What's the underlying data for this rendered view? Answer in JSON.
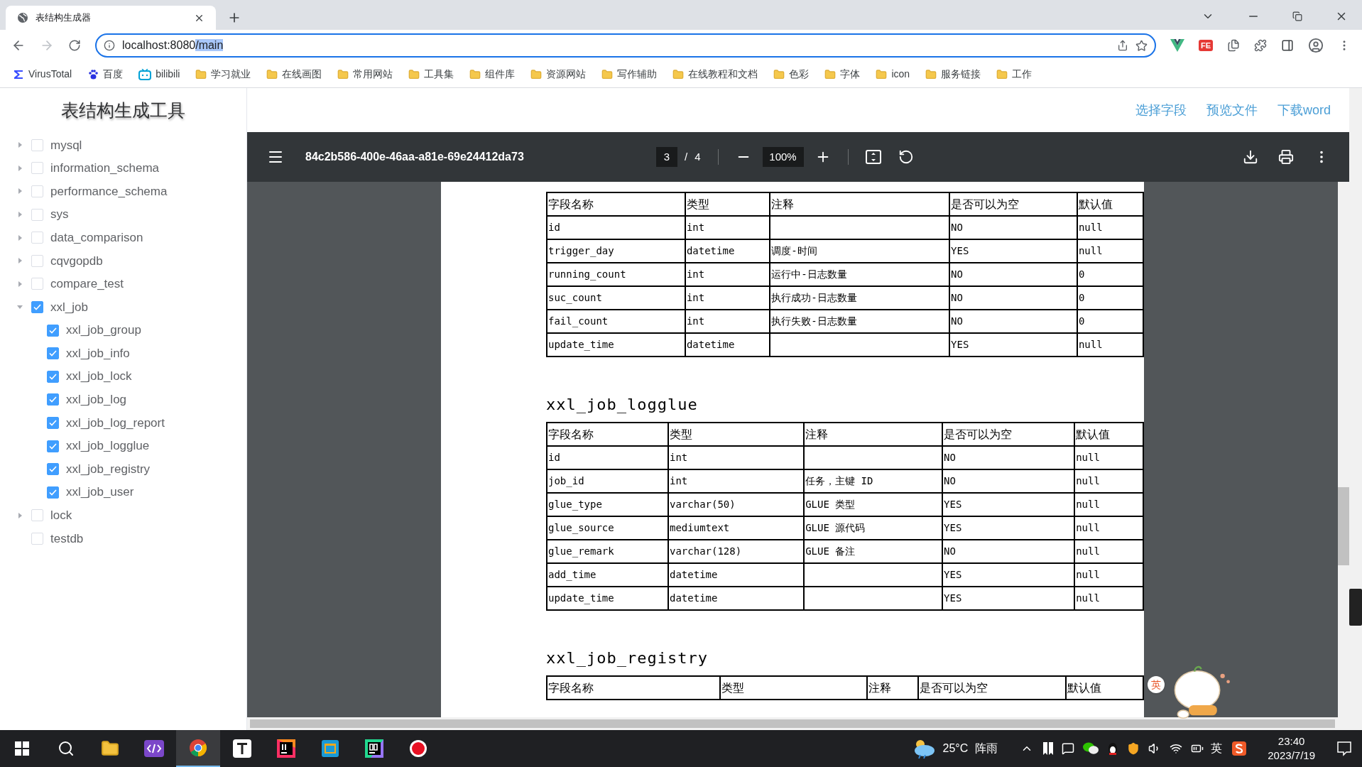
{
  "browser": {
    "tab_title": "表结构生成器",
    "address": {
      "host": "localhost:8080",
      "path": "/main",
      "path_selected": true
    },
    "bookmarks": [
      {
        "kind": "virustotal",
        "label": "VirusTotal"
      },
      {
        "kind": "baidu",
        "label": "百度"
      },
      {
        "kind": "bilibili",
        "label": "bilibili"
      },
      {
        "kind": "folder",
        "label": "学习就业"
      },
      {
        "kind": "folder",
        "label": "在线画图"
      },
      {
        "kind": "folder",
        "label": "常用网站"
      },
      {
        "kind": "folder",
        "label": "工具集"
      },
      {
        "kind": "folder",
        "label": "组件库"
      },
      {
        "kind": "folder",
        "label": "资源网站"
      },
      {
        "kind": "folder",
        "label": "写作辅助"
      },
      {
        "kind": "folder",
        "label": "在线教程和文档"
      },
      {
        "kind": "folder",
        "label": "色彩"
      },
      {
        "kind": "folder",
        "label": "字体"
      },
      {
        "kind": "folder",
        "label": "icon"
      },
      {
        "kind": "folder",
        "label": "服务链接"
      },
      {
        "kind": "folder",
        "label": "工作"
      }
    ]
  },
  "sidebar": {
    "title": "表结构生成工具",
    "tree": [
      {
        "label": "mysql",
        "expandable": true,
        "expanded": false,
        "checked": false
      },
      {
        "label": "information_schema",
        "expandable": true,
        "expanded": false,
        "checked": false
      },
      {
        "label": "performance_schema",
        "expandable": true,
        "expanded": false,
        "checked": false
      },
      {
        "label": "sys",
        "expandable": true,
        "expanded": false,
        "checked": false
      },
      {
        "label": "data_comparison",
        "expandable": true,
        "expanded": false,
        "checked": false
      },
      {
        "label": "cqvgopdb",
        "expandable": true,
        "expanded": false,
        "checked": false
      },
      {
        "label": "compare_test",
        "expandable": true,
        "expanded": false,
        "checked": false
      },
      {
        "label": "xxl_job",
        "expandable": true,
        "expanded": true,
        "checked": true,
        "children": [
          {
            "label": "xxl_job_group",
            "checked": true
          },
          {
            "label": "xxl_job_info",
            "checked": true
          },
          {
            "label": "xxl_job_lock",
            "checked": true
          },
          {
            "label": "xxl_job_log",
            "checked": true
          },
          {
            "label": "xxl_job_log_report",
            "checked": true
          },
          {
            "label": "xxl_job_logglue",
            "checked": true
          },
          {
            "label": "xxl_job_registry",
            "checked": true
          },
          {
            "label": "xxl_job_user",
            "checked": true
          }
        ]
      },
      {
        "label": "lock",
        "expandable": true,
        "expanded": false,
        "checked": false
      },
      {
        "label": "testdb",
        "expandable": false,
        "checked": false
      }
    ]
  },
  "header_links": [
    "选择字段",
    "预览文件",
    "下载word"
  ],
  "fe_extension": "FE",
  "pdf_toolbar": {
    "file_name": "84c2b586-400e-46aa-a81e-69e24412da73",
    "page": "3",
    "page_separator": "/",
    "page_total": "4",
    "zoom": "100%"
  },
  "pdf_page": {
    "tables": [
      {
        "columns": [
          "字段名称",
          "类型",
          "注释",
          "是否可以为空",
          "默认值"
        ],
        "rows": [
          [
            "id",
            "int",
            "",
            "NO",
            "null"
          ],
          [
            "trigger_day",
            "datetime",
            "调度-时间",
            "YES",
            "null"
          ],
          [
            "running_count",
            "int",
            "运行中-日志数量",
            "NO",
            "0"
          ],
          [
            "suc_count",
            "int",
            "执行成功-日志数量",
            "NO",
            "0"
          ],
          [
            "fail_count",
            "int",
            "执行失败-日志数量",
            "NO",
            "0"
          ],
          [
            "update_time",
            "datetime",
            "",
            "YES",
            "null"
          ]
        ]
      },
      {
        "title": "xxl_job_logglue",
        "columns": [
          "字段名称",
          "类型",
          "注释",
          "是否可以为空",
          "默认值"
        ],
        "rows": [
          [
            "id",
            "int",
            "",
            "NO",
            "null"
          ],
          [
            "job_id",
            "int",
            "任务，主键 ID",
            "NO",
            "null"
          ],
          [
            "glue_type",
            "varchar(50)",
            "GLUE 类型",
            "YES",
            "null"
          ],
          [
            "glue_source",
            "mediumtext",
            "GLUE 源代码",
            "YES",
            "null"
          ],
          [
            "glue_remark",
            "varchar(128)",
            "GLUE 备注",
            "NO",
            "null"
          ],
          [
            "add_time",
            "datetime",
            "",
            "YES",
            "null"
          ],
          [
            "update_time",
            "datetime",
            "",
            "YES",
            "null"
          ]
        ]
      },
      {
        "title": "xxl_job_registry",
        "columns": [
          "字段名称",
          "类型",
          "注释",
          "是否可以为空",
          "默认值"
        ]
      }
    ]
  },
  "ime_badge": "英",
  "taskbar": {
    "apps": [
      {
        "kind": "start",
        "selected": false
      },
      {
        "kind": "search",
        "selected": false
      },
      {
        "kind": "explorer",
        "selected": false
      },
      {
        "kind": "code",
        "selected": false
      },
      {
        "kind": "chrome",
        "selected": true
      },
      {
        "kind": "typora",
        "selected": false
      },
      {
        "kind": "idea",
        "selected": false
      },
      {
        "kind": "window",
        "selected": false
      },
      {
        "kind": "datagrip",
        "selected": false
      },
      {
        "kind": "record",
        "selected": false
      }
    ],
    "temperature": "25°C",
    "weather": "阵雨",
    "ime": "英",
    "time": "23:40",
    "date": "2023/7/19"
  }
}
